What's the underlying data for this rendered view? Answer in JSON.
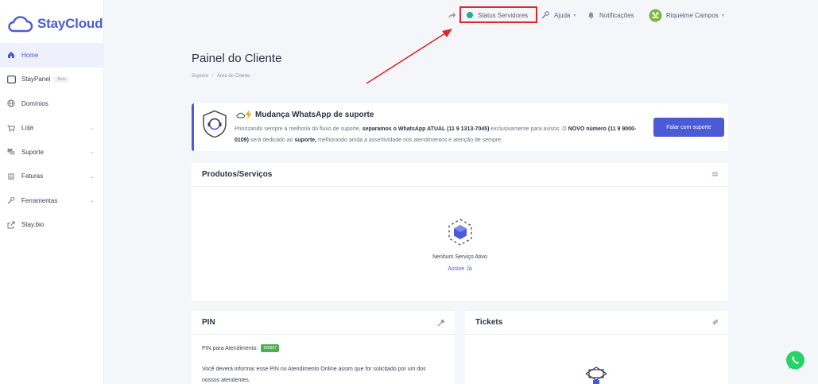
{
  "brand": {
    "name": "StayCloud",
    "accent": "#4b5bd6"
  },
  "sidebar": {
    "items": [
      {
        "label": "Home",
        "icon": "home-icon",
        "active": true
      },
      {
        "label": "StayPanel",
        "badge": "Beta",
        "icon": "panel-icon"
      },
      {
        "label": "Domínios",
        "icon": "globe-icon"
      },
      {
        "label": "Loja",
        "icon": "cart-icon",
        "chevron": true
      },
      {
        "label": "Suporte",
        "icon": "chat-icon",
        "chevron": true
      },
      {
        "label": "Faturas",
        "icon": "invoice-icon",
        "chevron": true
      },
      {
        "label": "Ferramentas",
        "icon": "wrench-icon",
        "chevron": true
      },
      {
        "label": "Stay.bio",
        "icon": "external-link-icon"
      }
    ]
  },
  "topbar": {
    "status": "Status Servidores",
    "help": "Ajuda",
    "notifications": "Notificações",
    "user": "Riquelme Campos",
    "status_color": "#22b07d"
  },
  "page": {
    "title": "Painel do Cliente",
    "breadcrumb": [
      "Suporte",
      "Área do Cliente"
    ]
  },
  "announcement": {
    "title": "Mudança WhatsApp de suporte",
    "t1": "Priorizando sempre a melhoria do fluxo de suporte, ",
    "b1": "separamos o WhatsApp ATUAL (11 9 1313-7045)",
    "t2": " exclusivamente para avisos. O ",
    "b2": "NOVO número (11 9 9000-0109)",
    "t3": " será dedicado ao ",
    "b3": "suporte,",
    "t4": " melhorando ainda a assertividade nos atendimentos e atenção de sempre.",
    "button": "Falar com suporte"
  },
  "products": {
    "title": "Produtos/Serviços",
    "empty": "Nenhum Serviço Ativo",
    "link": "Assine Já"
  },
  "pin": {
    "title": "PIN",
    "label": "PIN para Atendimento:",
    "code": "920837",
    "description": "Você deverá informar esse PIN no Atendimento Online assim que for solicitado por um dos nossos atendentes."
  },
  "tickets": {
    "title": "Tickets"
  }
}
